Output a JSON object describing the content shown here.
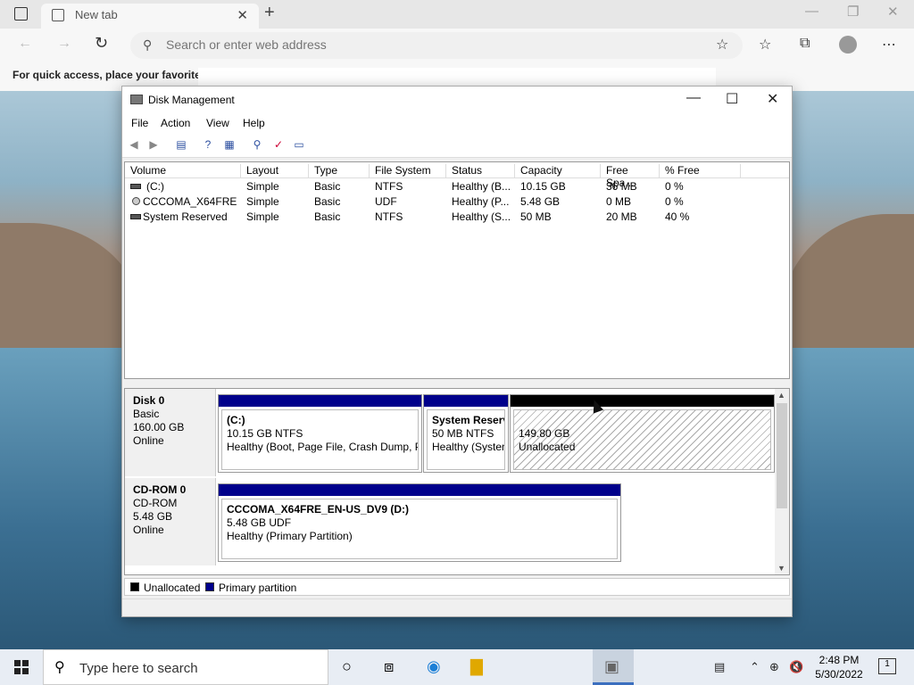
{
  "browser": {
    "tab_title": "New tab",
    "tab_close": "✕",
    "new_tab": "+",
    "address_placeholder": "Search or enter web address",
    "favorites_text": "For quick access, place your favorites h"
  },
  "window": {
    "title": "Disk Management",
    "menu": [
      "File",
      "Action",
      "View",
      "Help"
    ]
  },
  "volume_list": {
    "columns": [
      "Volume",
      "Layout",
      "Type",
      "File System",
      "Status",
      "Capacity",
      "Free Spa...",
      "% Free"
    ],
    "rows": [
      {
        "volume": "(C:)",
        "layout": "Simple",
        "type": "Basic",
        "fs": "NTFS",
        "status": "Healthy (B...",
        "capacity": "10.15 GB",
        "free": "36 MB",
        "pct": "0 %",
        "icon": "drive-icon"
      },
      {
        "volume": "CCCOMA_X64FRE...",
        "layout": "Simple",
        "type": "Basic",
        "fs": "UDF",
        "status": "Healthy (P...",
        "capacity": "5.48 GB",
        "free": "0 MB",
        "pct": "0 %",
        "icon": "cdrom-icon"
      },
      {
        "volume": "System Reserved",
        "layout": "Simple",
        "type": "Basic",
        "fs": "NTFS",
        "status": "Healthy (S...",
        "capacity": "50 MB",
        "free": "20 MB",
        "pct": "40 %",
        "icon": "drive-icon"
      }
    ]
  },
  "disks": [
    {
      "name": "Disk 0",
      "type": "Basic",
      "size": "160.00 GB",
      "state": "Online",
      "partitions": [
        {
          "title": "(C:)",
          "line1": "10.15 GB NTFS",
          "line2": "Healthy (Boot, Page File, Crash Dump, Pr"
        },
        {
          "title": "System Reserv",
          "line1": "50 MB NTFS",
          "line2": "Healthy (Systen"
        },
        {
          "title": "",
          "line1": "149.80 GB",
          "line2": "Unallocated"
        }
      ]
    },
    {
      "name": "CD-ROM 0",
      "type": "CD-ROM",
      "size": "5.48 GB",
      "state": "Online",
      "partitions": [
        {
          "title": "CCCOMA_X64FRE_EN-US_DV9  (D:)",
          "line1": "5.48 GB UDF",
          "line2": "Healthy (Primary Partition)"
        }
      ]
    }
  ],
  "legend": {
    "unallocated": "Unallocated",
    "primary": "Primary partition"
  },
  "colors": {
    "primary_partition": "#00008b",
    "unallocated": "#000000"
  },
  "taskbar": {
    "search_placeholder": "Type here to search",
    "time": "2:48 PM",
    "date": "5/30/2022",
    "notifications": "1"
  }
}
